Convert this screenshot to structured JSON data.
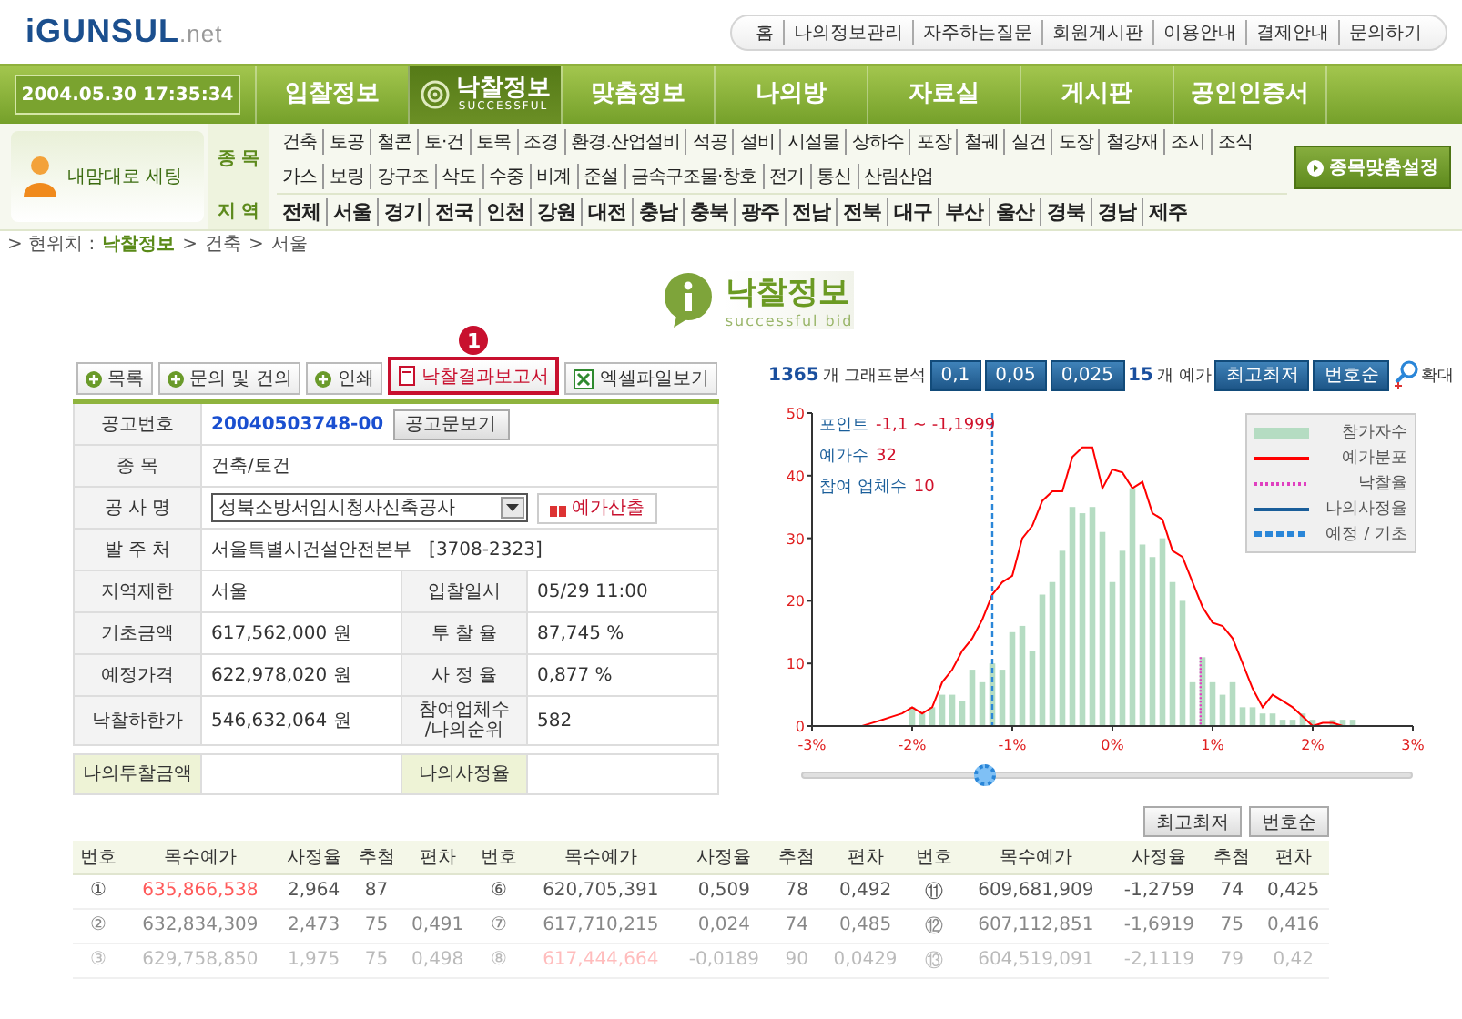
{
  "logo": {
    "name": "iGUNSUL",
    "suffix": ".net"
  },
  "top_links": [
    "홈",
    "나의정보관리",
    "자주하는질문",
    "회원게시판",
    "이용안내",
    "결제안내",
    "문의하기"
  ],
  "clock": "2004.05.30 17:35:34",
  "nav": [
    {
      "label": "입찰정보",
      "selected": false
    },
    {
      "label": "낙찰정보",
      "sub": "SUCCESSFUL",
      "selected": true
    },
    {
      "label": "맞춤정보",
      "selected": false
    },
    {
      "label": "나의방",
      "selected": false
    },
    {
      "label": "자료실",
      "selected": false
    },
    {
      "label": "게시판",
      "selected": false
    },
    {
      "label": "공인인증서",
      "selected": false
    }
  ],
  "user_setting": "내맘대로 세팅",
  "filters": [
    {
      "label": "종 목",
      "rows": [
        [
          "건축",
          "토공",
          "철콘",
          "토·건",
          "토목",
          "조경",
          "환경.산업설비",
          "석공",
          "설비",
          "시설물",
          "상하수",
          "포장",
          "철궤",
          "실건",
          "도장",
          "철강재",
          "조시",
          "조식"
        ],
        [
          "가스",
          "보링",
          "강구조",
          "삭도",
          "수중",
          "비계",
          "준설",
          "금속구조물·창호",
          "전기",
          "통신",
          "산림산업"
        ]
      ]
    },
    {
      "label": "지 역",
      "rows": [
        [
          "전체",
          "서울",
          "경기",
          "전국",
          "인천",
          "강원",
          "대전",
          "충남",
          "충북",
          "광주",
          "전남",
          "전북",
          "대구",
          "부산",
          "울산",
          "경북",
          "경남",
          "제주"
        ]
      ]
    }
  ],
  "custom_button": "종목맞춤설정",
  "breadcrumb": {
    "prefix": "> 현위치 :",
    "separator": ">",
    "items": [
      "낙찰정보",
      "건축",
      "서울"
    ]
  },
  "page_title": {
    "title": "낙찰정보",
    "subtitle": "successful bid"
  },
  "actions": [
    {
      "label": "목록",
      "kind": "basic",
      "highlighted": false
    },
    {
      "label": "문의 및 건의",
      "kind": "basic",
      "highlighted": false
    },
    {
      "label": "인쇄",
      "kind": "basic",
      "highlighted": false
    },
    {
      "label": "낙찰결과보고서",
      "kind": "report",
      "highlighted": true,
      "badge": "1"
    },
    {
      "label": "엑셀파일보기",
      "kind": "excel",
      "highlighted": false
    }
  ],
  "details": [
    {
      "kind": "link",
      "label": "공고번호",
      "value": "20040503748-00",
      "button": "공고문보기"
    },
    {
      "kind": "text",
      "label": "종      목",
      "value": "건축/토건"
    },
    {
      "kind": "select",
      "label": "공 사 명",
      "value": "성북소방서임시청사신축공사",
      "button": "예가산출"
    },
    {
      "kind": "text",
      "label": "발 주 처",
      "value": "서울특별시건설안전본부   [3708-2323]"
    },
    {
      "kind": "pair",
      "cells": [
        {
          "label": "지역제한",
          "value": "서울"
        },
        {
          "label": "입찰일시",
          "value": "05/29 11:00"
        }
      ]
    },
    {
      "kind": "pair",
      "cells": [
        {
          "label": "기초금액",
          "value": "617,562,000 원"
        },
        {
          "label": "투 찰 율",
          "value": "87,745 %"
        }
      ]
    },
    {
      "kind": "pair",
      "cells": [
        {
          "label": "예정가격",
          "value": "622,978,020 원"
        },
        {
          "label": "사 정 율",
          "value": "0,877 %"
        }
      ]
    },
    {
      "kind": "pair",
      "cells": [
        {
          "label": "낙찰하한가",
          "value": "546,632,064 원"
        },
        {
          "label": "참여업체수\n/나의순위",
          "value": "582"
        }
      ]
    }
  ],
  "my_row": [
    {
      "label": "나의투찰금액"
    },
    {
      "label": "나의사정율"
    }
  ],
  "chart_toolbar": {
    "count": "1365",
    "count_label": "개 그래프분석",
    "steps": [
      "0,1",
      "0,05",
      "0,025"
    ],
    "estimate_count": "15",
    "estimate_label": "개 예가",
    "buttons": [
      "최고최저",
      "번호순"
    ],
    "zoom": "확대"
  },
  "chart": {
    "info": [
      {
        "label": "포인트",
        "value": "-1,1 ~ -1,1999"
      },
      {
        "label": "예가수",
        "value": "32"
      },
      {
        "label": "참여 업체수",
        "value": "10"
      }
    ],
    "legend": [
      {
        "label": "낙찰율",
        "kind": "dotted",
        "color": "#e040c0"
      },
      {
        "label": "나의사정율",
        "kind": "solid",
        "color": "#1a5e9a"
      },
      {
        "label": "예정 / 기초",
        "kind": "dashed",
        "color": "#2a86d8"
      }
    ],
    "slider": {
      "level": 0.3
    },
    "chart_data": {
      "type": "bar",
      "x": [
        -2.5,
        -2.4,
        -2.3,
        -2.2,
        -2.1,
        -2.0,
        -1.9,
        -1.8,
        -1.7,
        -1.6,
        -1.5,
        -1.4,
        -1.3,
        -1.2,
        -1.1,
        -1.0,
        -0.9,
        -0.8,
        -0.7,
        -0.6,
        -0.5,
        -0.4,
        -0.3,
        -0.2,
        -0.1,
        0.0,
        0.1,
        0.2,
        0.3,
        0.4,
        0.5,
        0.6,
        0.7,
        0.8,
        0.9,
        1.0,
        1.1,
        1.2,
        1.3,
        1.4,
        1.5,
        1.6,
        1.7,
        1.8,
        1.9,
        2.0,
        2.1,
        2.2,
        2.3,
        2.4
      ],
      "series": [
        {
          "name": "참가자수",
          "color": "#b5dcc2",
          "values": [
            null,
            null,
            null,
            null,
            null,
            3,
            2,
            3,
            5,
            5,
            4,
            9,
            7,
            10,
            9,
            15,
            16,
            12,
            21,
            23,
            28,
            35,
            34,
            35,
            31,
            23,
            28,
            38,
            29,
            27,
            30,
            23,
            20,
            7,
            11,
            7,
            5,
            7,
            3,
            3,
            2,
            2,
            1,
            1,
            2,
            1,
            0,
            1,
            1,
            1
          ]
        },
        {
          "name": "예가분포",
          "type": "line",
          "color": "#ff0000",
          "values": [
            0,
            0.5,
            1,
            1.5,
            2,
            3,
            2,
            3,
            7,
            9,
            12,
            14,
            17,
            21,
            23,
            24,
            30,
            32,
            36,
            37.5,
            37.5,
            43,
            44.5,
            44.5,
            38,
            41,
            40.5,
            38,
            39,
            34,
            33,
            28,
            27,
            23,
            19,
            16.5,
            16,
            14,
            10,
            6,
            3,
            5,
            4,
            3,
            1.5,
            0,
            0.5,
            0.5,
            0,
            null
          ]
        }
      ],
      "xlim": [
        -3,
        3
      ],
      "ylim": [
        0,
        50
      ],
      "xticks": [
        {
          "value": -3,
          "label": "-3%"
        },
        {
          "value": -2,
          "label": "-2%"
        },
        {
          "value": -1,
          "label": "-1%"
        },
        {
          "value": 0,
          "label": "0%"
        },
        {
          "value": 1,
          "label": "1%"
        },
        {
          "value": 2,
          "label": "2%"
        },
        {
          "value": 3,
          "label": "3%"
        }
      ],
      "yticks": [
        0,
        10,
        20,
        30,
        40,
        50
      ],
      "ref_lines": [
        {
          "axis": "x",
          "value": -1.2
        },
        {
          "axis": "x",
          "value": 0.88
        }
      ]
    }
  },
  "table": {
    "buttons": [
      "최고최저",
      "번호순"
    ],
    "columns": [
      "번호",
      "목수예가",
      "사정율",
      "추첨",
      "편차",
      "번호",
      "목수예가",
      "사정율",
      "추첨",
      "편차",
      "번호",
      "목수예가",
      "사정율",
      "추첨",
      "편차"
    ],
    "rows": [
      {
        "groups": [
          {
            "no": "①",
            "price": "635,866,538",
            "highlight": true,
            "rate": "2,964",
            "pick": "87"
          },
          {
            "no": "⑥",
            "price": "620,705,391",
            "highlight": false,
            "rate": "0,509",
            "pick": "78",
            "deviation": "0,492"
          },
          {
            "no": "⑪",
            "price": "609,681,909",
            "highlight": false,
            "rate": "-1,2759",
            "pick": "74",
            "deviation": "0,425"
          }
        ]
      },
      {
        "groups": [
          {
            "no": "②",
            "price": "632,834,309",
            "highlight": false,
            "rate": "2,473",
            "pick": "75",
            "deviation": "0,491"
          },
          {
            "no": "⑦",
            "price": "617,710,215",
            "highlight": false,
            "rate": "0,024",
            "pick": "74",
            "deviation": "0,485"
          },
          {
            "no": "⑫",
            "price": "607,112,851",
            "highlight": false,
            "rate": "-1,6919",
            "pick": "75",
            "deviation": "0,416"
          }
        ]
      },
      {
        "groups": [
          {
            "no": "③",
            "price": "629,758,850",
            "highlight": false,
            "rate": "1,975",
            "pick": "75",
            "deviation": "0,498"
          },
          {
            "no": "⑧",
            "price": "617,444,664",
            "highlight": true,
            "rate": "-0,0189",
            "pick": "90",
            "deviation": "0,0429"
          },
          {
            "no": "⑬",
            "price": "604,519,091",
            "highlight": false,
            "rate": "-2,1119",
            "pick": "79",
            "deviation": "0,42"
          }
        ]
      }
    ]
  }
}
